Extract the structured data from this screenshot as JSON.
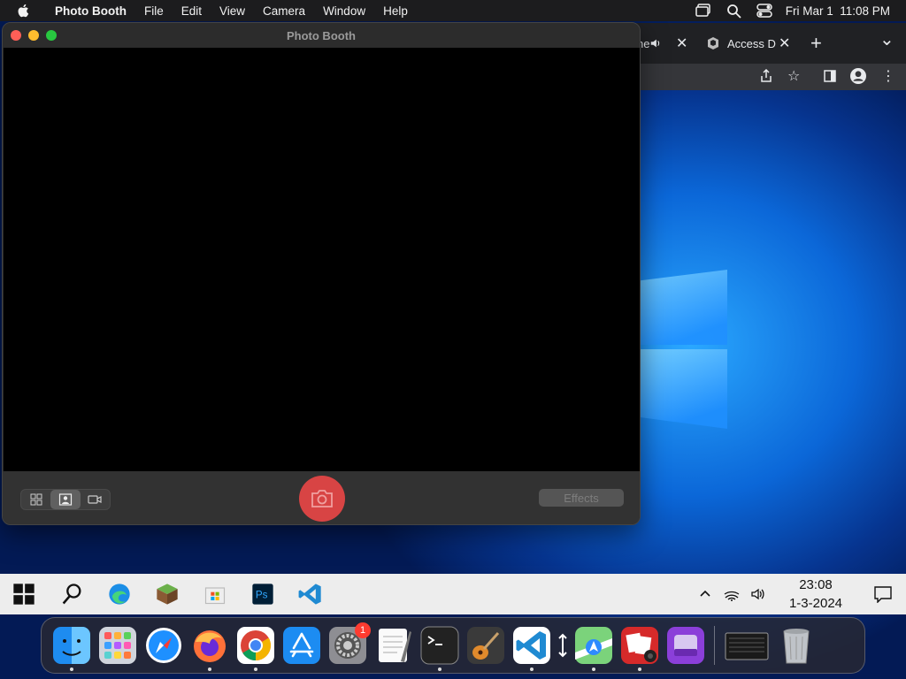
{
  "menubar": {
    "app_name": "Photo Booth",
    "menus": [
      "File",
      "Edit",
      "View",
      "Camera",
      "Window",
      "Help"
    ],
    "datetime": "Fri Mar 1  11:08 PM"
  },
  "browser": {
    "tab_partial_text": "ne",
    "tab2_title": "Access D",
    "new_tab": "+",
    "dropdown": "⌄"
  },
  "photobooth": {
    "title": "Photo Booth",
    "effects_label": "Effects"
  },
  "taskbar": {
    "time": "23:08",
    "date": "1-3-2024"
  },
  "dock": {
    "settings_badge": "1"
  }
}
